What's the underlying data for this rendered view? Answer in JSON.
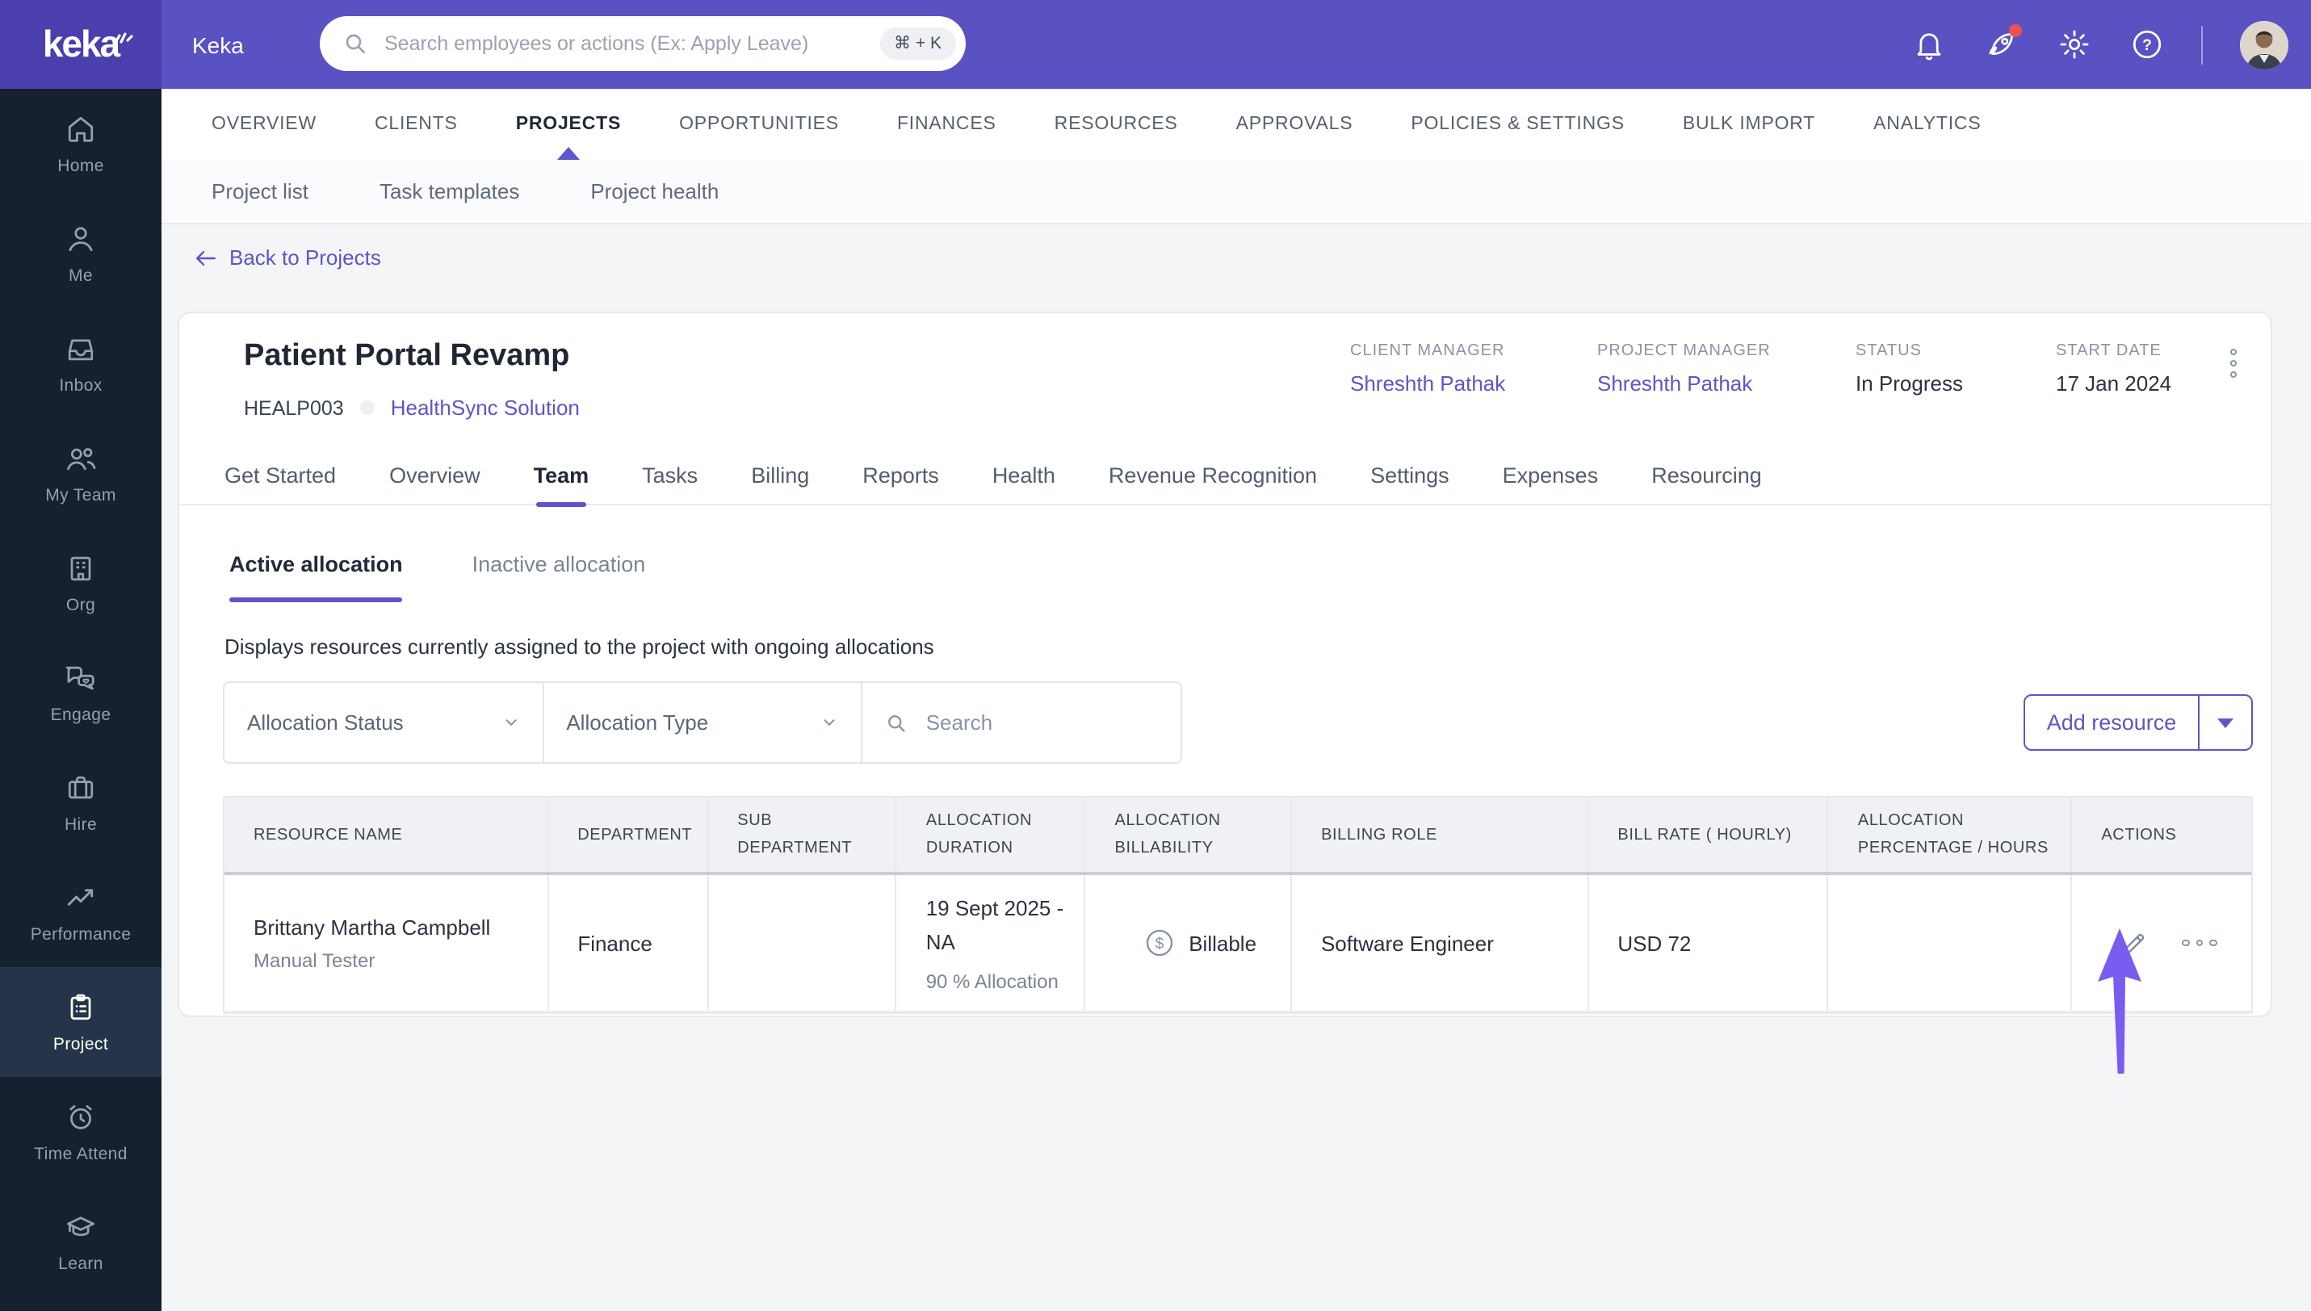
{
  "colors": {
    "brand_purple": "#5a51c3",
    "brand_purple_dark": "#4b3fae",
    "sidebar_bg": "#16202e",
    "accent_purple": "#5f54c9",
    "annotation_arrow": "#7a5cf0",
    "notification_badge_red": "#ef5350"
  },
  "topbar": {
    "logo_text": "keka",
    "app_label": "Keka",
    "search_placeholder": "Search employees or actions (Ex: Apply Leave)",
    "shortcut_badge": "⌘ + K"
  },
  "sidebar": {
    "items": [
      {
        "label": "Home",
        "icon": "home-icon",
        "active": false
      },
      {
        "label": "Me",
        "icon": "user-icon",
        "active": false
      },
      {
        "label": "Inbox",
        "icon": "inbox-icon",
        "active": false
      },
      {
        "label": "My Team",
        "icon": "team-icon",
        "active": false
      },
      {
        "label": "Org",
        "icon": "building-icon",
        "active": false
      },
      {
        "label": "Engage",
        "icon": "chat-icon",
        "active": false
      },
      {
        "label": "Hire",
        "icon": "briefcase-icon",
        "active": false
      },
      {
        "label": "Performance",
        "icon": "trend-icon",
        "active": false
      },
      {
        "label": "Project",
        "icon": "clipboard-icon",
        "active": true
      },
      {
        "label": "Time Attend",
        "icon": "alarm-icon",
        "active": false
      },
      {
        "label": "Learn",
        "icon": "graduation-icon",
        "active": false
      }
    ]
  },
  "main_nav": {
    "items": [
      "OVERVIEW",
      "CLIENTS",
      "PROJECTS",
      "OPPORTUNITIES",
      "FINANCES",
      "RESOURCES",
      "APPROVALS",
      "POLICIES & SETTINGS",
      "BULK IMPORT",
      "ANALYTICS"
    ],
    "active": "PROJECTS"
  },
  "sub_nav": {
    "items": [
      "Project list",
      "Task templates",
      "Project health"
    ]
  },
  "back_link": "Back to Projects",
  "project": {
    "title": "Patient Portal Revamp",
    "code": "HEALP003",
    "client_link": "HealthSync Solution",
    "meta": [
      {
        "label": "CLIENT MANAGER",
        "value": "Shreshth Pathak"
      },
      {
        "label": "PROJECT MANAGER",
        "value": "Shreshth Pathak"
      },
      {
        "label": "STATUS",
        "value": "In Progress"
      },
      {
        "label": "START DATE",
        "value": "17 Jan 2024"
      }
    ],
    "tabs": {
      "items": [
        "Get Started",
        "Overview",
        "Team",
        "Tasks",
        "Billing",
        "Reports",
        "Health",
        "Revenue Recognition",
        "Settings",
        "Expenses",
        "Resourcing"
      ],
      "active": "Team"
    }
  },
  "team_section": {
    "allocation_tabs": {
      "items": [
        "Active allocation",
        "Inactive allocation"
      ],
      "active": "Active allocation"
    },
    "description": "Displays resources currently assigned to the project with ongoing allocations",
    "filters": {
      "allocation_status_label": "Allocation Status",
      "allocation_type_label": "Allocation Type",
      "search_placeholder": "Search"
    },
    "add_resource_label": "Add resource",
    "table": {
      "columns": [
        "RESOURCE NAME",
        "DEPARTMENT",
        "SUB DEPARTMENT",
        "ALLOCATION DURATION",
        "ALLOCATION BILLABILITY",
        "BILLING ROLE",
        "BILL RATE ( HOURLY)",
        "ALLOCATION PERCENTAGE / HOURS",
        "ACTIONS"
      ],
      "rows": [
        {
          "resource_name": "Brittany Martha Campbell",
          "resource_role": "Manual Tester",
          "department": "Finance",
          "sub_department": "",
          "allocation_duration": "19 Sept 2025 - NA",
          "allocation_note": "90 % Allocation",
          "billability": "Billable",
          "billing_role": "Software Engineer",
          "bill_rate": "USD 72",
          "allocation_percentage_hours": ""
        }
      ]
    }
  }
}
